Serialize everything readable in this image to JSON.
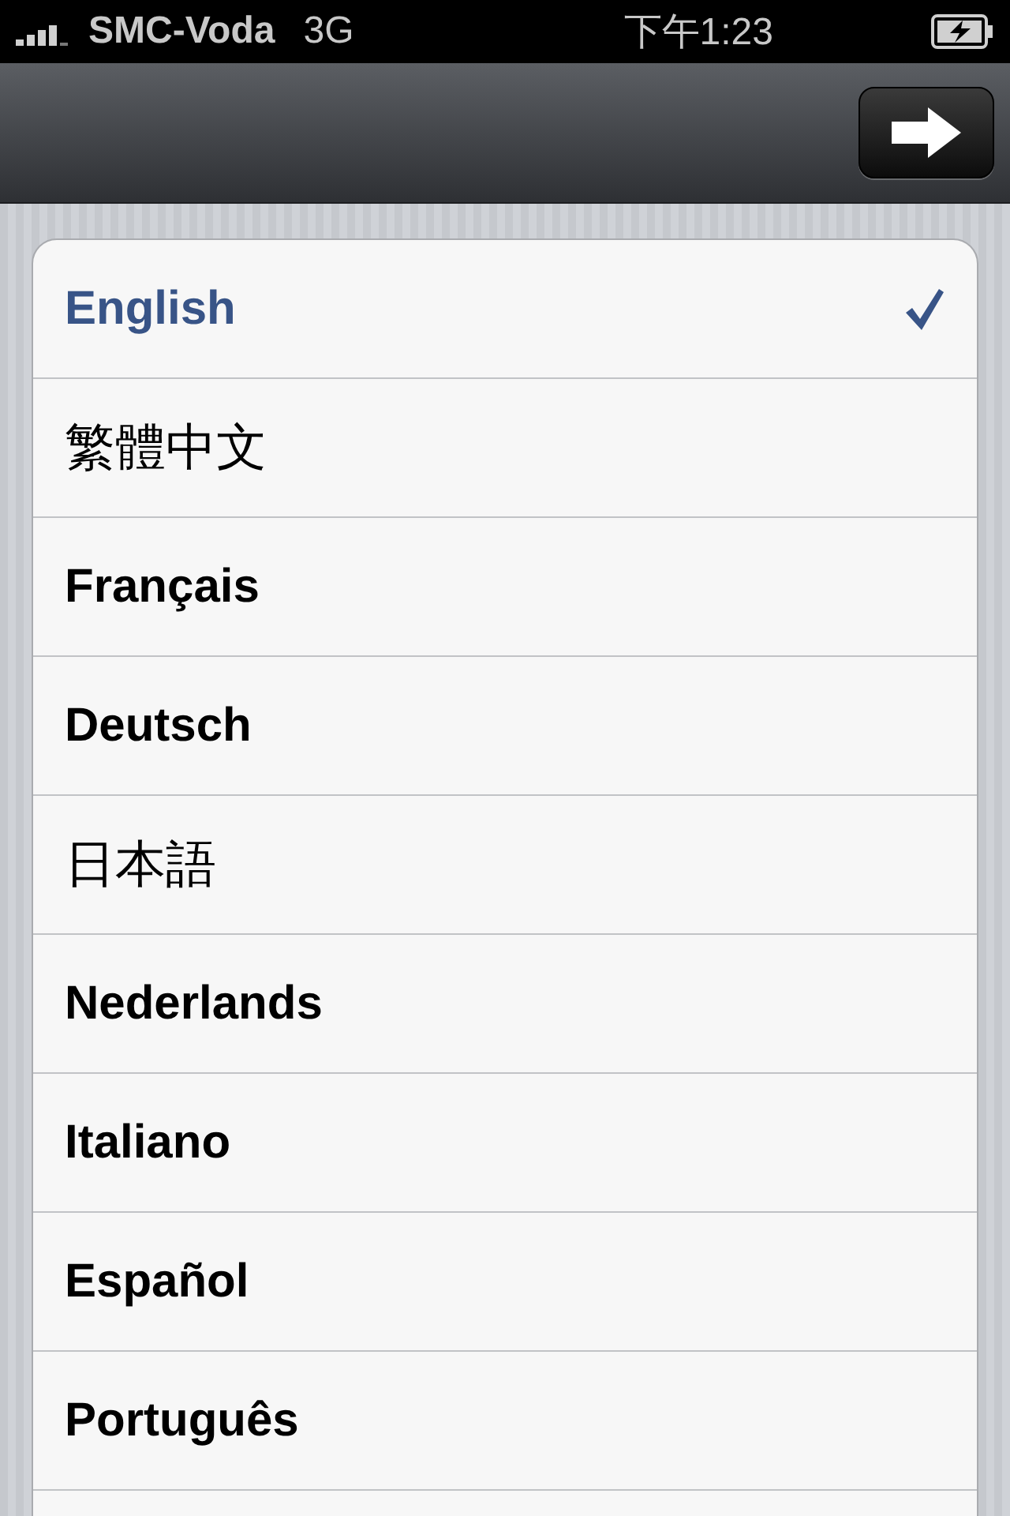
{
  "status_bar": {
    "carrier": "SMC-Voda",
    "network": "3G",
    "time": "下午1:23"
  },
  "languages": [
    {
      "label": "English",
      "kind": "latin",
      "selected": true
    },
    {
      "label": "繁體中文",
      "kind": "cjk",
      "selected": false
    },
    {
      "label": "Français",
      "kind": "latin",
      "selected": false
    },
    {
      "label": "Deutsch",
      "kind": "latin",
      "selected": false
    },
    {
      "label": "日本語",
      "kind": "cjk",
      "selected": false
    },
    {
      "label": "Nederlands",
      "kind": "latin",
      "selected": false
    },
    {
      "label": "Italiano",
      "kind": "latin",
      "selected": false
    },
    {
      "label": "Español",
      "kind": "latin",
      "selected": false
    },
    {
      "label": "Português",
      "kind": "latin",
      "selected": false
    }
  ]
}
